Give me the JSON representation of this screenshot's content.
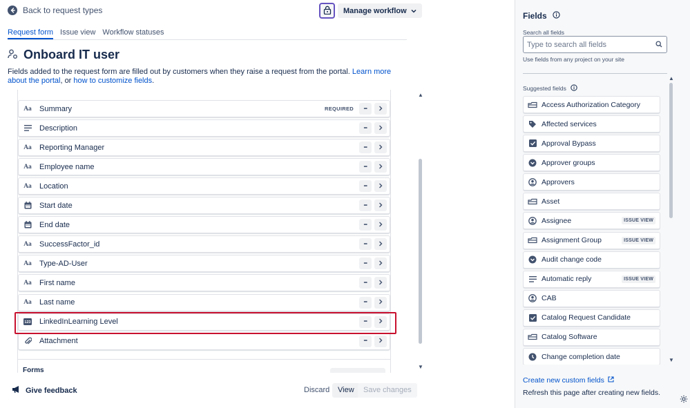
{
  "header": {
    "back_label": "Back to request types",
    "manage_label": "Manage workflow"
  },
  "tabs": [
    {
      "label": "Request form",
      "active": true
    },
    {
      "label": "Issue view",
      "active": false
    },
    {
      "label": "Workflow statuses",
      "active": false
    }
  ],
  "page": {
    "title": "Onboard IT user",
    "desc_prefix": "Fields added to the request form are filled out by customers when they raise a request from the portal. ",
    "link1": "Learn more about the portal",
    "desc_mid": ", or ",
    "link2": "how to customize fields",
    "desc_end": "."
  },
  "fields": [
    {
      "label": "Summary",
      "icon": "text-icon",
      "badge": "REQUIRED"
    },
    {
      "label": "Description",
      "icon": "paragraph-icon",
      "badge": ""
    },
    {
      "label": "Reporting Manager",
      "icon": "text-icon",
      "badge": ""
    },
    {
      "label": "Employee name",
      "icon": "text-icon",
      "badge": ""
    },
    {
      "label": "Location",
      "icon": "text-icon",
      "badge": ""
    },
    {
      "label": "Start date",
      "icon": "calendar-icon",
      "badge": ""
    },
    {
      "label": "End date",
      "icon": "calendar-icon",
      "badge": ""
    },
    {
      "label": "SuccessFactor_id",
      "icon": "text-icon",
      "badge": ""
    },
    {
      "label": "Type-AD-User",
      "icon": "text-icon",
      "badge": ""
    },
    {
      "label": "First name",
      "icon": "text-icon",
      "badge": ""
    },
    {
      "label": "Last name",
      "icon": "text-icon",
      "badge": ""
    },
    {
      "label": "LinkedInLearning Level",
      "icon": "number-icon",
      "badge": ""
    },
    {
      "label": "Attachment",
      "icon": "paperclip-icon",
      "badge": ""
    }
  ],
  "forms_label": "Forms",
  "footer": {
    "feedback": "Give feedback",
    "discard": "Discard",
    "view": "View",
    "save": "Save changes"
  },
  "right_panel": {
    "title": "Fields",
    "search_label": "Search all fields",
    "search_placeholder": "Type to search all fields",
    "hint": "Use fields from any project on your site",
    "suggested_label": "Suggested fields",
    "items": [
      {
        "label": "Access Authorization Category",
        "icon": "asset-icon",
        "badge": ""
      },
      {
        "label": "Affected services",
        "icon": "tag-icon",
        "badge": ""
      },
      {
        "label": "Approval Bypass",
        "icon": "checkbox-icon",
        "badge": ""
      },
      {
        "label": "Approver groups",
        "icon": "dropdown-circle-icon",
        "badge": ""
      },
      {
        "label": "Approvers",
        "icon": "user-icon",
        "badge": ""
      },
      {
        "label": "Asset",
        "icon": "asset-icon",
        "badge": ""
      },
      {
        "label": "Assignee",
        "icon": "user-icon",
        "badge": "ISSUE VIEW"
      },
      {
        "label": "Assignment Group",
        "icon": "asset-icon",
        "badge": "ISSUE VIEW"
      },
      {
        "label": "Audit change code",
        "icon": "dropdown-circle-icon",
        "badge": ""
      },
      {
        "label": "Automatic reply",
        "icon": "paragraph-icon",
        "badge": "ISSUE VIEW"
      },
      {
        "label": "CAB",
        "icon": "user-icon",
        "badge": ""
      },
      {
        "label": "Catalog Request Candidate",
        "icon": "checkbox-icon",
        "badge": ""
      },
      {
        "label": "Catalog Software",
        "icon": "asset-icon",
        "badge": ""
      },
      {
        "label": "Change completion date",
        "icon": "clock-icon",
        "badge": ""
      }
    ],
    "create_link": "Create new custom fields",
    "refresh_text": "Refresh this page after creating new fields."
  }
}
